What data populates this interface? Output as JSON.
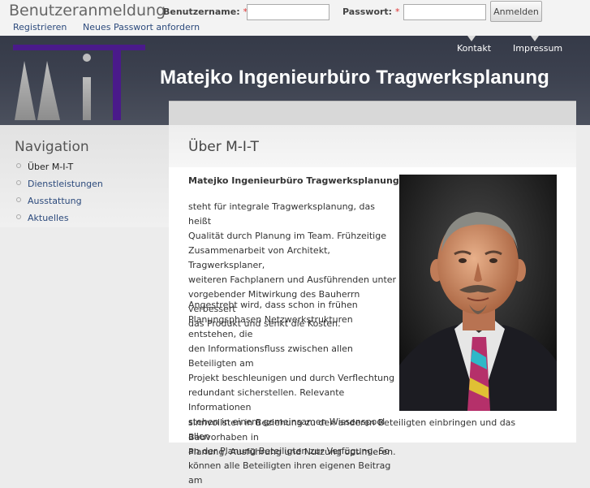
{
  "login": {
    "title": "Benutzeranmeldung",
    "username_label": "Benutzername:",
    "password_label": "Passwort:",
    "required_mark": "*",
    "submit_label": "Anmelden",
    "register_link": "Registrieren",
    "forgot_link": "Neues Passwort anfordern"
  },
  "header": {
    "site_title": "Matejko Ingenieurbüro Tragwerksplanung",
    "links": [
      "Kontakt",
      "Impressum"
    ]
  },
  "sidebar": {
    "title": "Navigation",
    "items": [
      {
        "label": "Über M-I-T",
        "active": true
      },
      {
        "label": "Dienstleistungen",
        "active": false
      },
      {
        "label": "Ausstattung",
        "active": false
      },
      {
        "label": "Aktuelles",
        "active": false
      }
    ]
  },
  "main": {
    "title": "Über M-I-T",
    "intro_strong": "Matejko Ingenieurbüro Tragwerksplanung",
    "para1_lines": [
      "steht für integrale Tragwerksplanung, das heißt",
      "Qualität durch Planung im Team. Frühzeitige",
      "Zusammenarbeit von Architekt, Tragwerksplaner,",
      "weiteren Fachplanern und Ausführenden unter",
      "vorgebender Mitwirkung des Bauherrn verbessert",
      "das Produkt und senkt die Kosten."
    ],
    "para2_lines": [
      "Angestrebt wird, dass schon in frühen",
      "Planungsphasen Netzwerkstrukturen entstehen, die",
      "den Informationsfluss zwischen allen Beteiligten am",
      "Projekt beschleunigen und durch Verflechtung",
      "redundant sicherstellen. Relevante Informationen",
      "stehen in einem gemeinsamen Wissenspool allen",
      "an der Planung Beteiligten zur Verfügung. So",
      "können alle Beteiligten ihren eigenen Beitrag am"
    ],
    "para3_lines": [
      "sinnvollsten in Beziehung zu den anderen Beteiligten einbringen und das Bauvorhaben in",
      "Planung, Ausführung und Nutzung optimieren."
    ]
  },
  "colors": {
    "header_bg": "#3c414f",
    "logo_purple": "#4a1a8a",
    "link_blue": "#2c4a7c"
  }
}
